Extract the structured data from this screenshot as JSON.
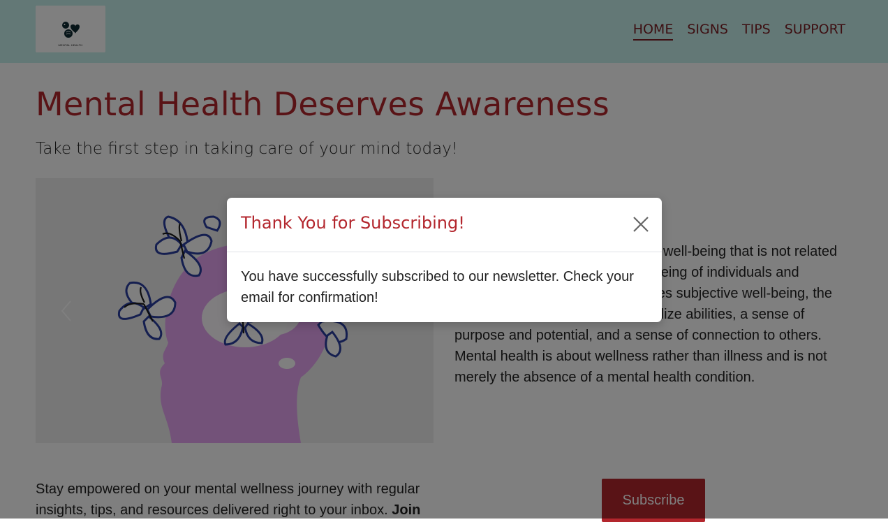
{
  "header": {
    "logo_text": "MENTAL HEALTH",
    "logo_icon": "brain-heart-logo",
    "nav": [
      {
        "label": "HOME",
        "active": true
      },
      {
        "label": "SIGNS"
      },
      {
        "label": "TIPS"
      },
      {
        "label": "SUPPORT"
      }
    ]
  },
  "hero": {
    "title": "Mental Health Deserves Awareness",
    "subtitle": "Take the first step in taking care of your mind today!"
  },
  "carousel": {
    "image": "head-with-butterflies-illustration",
    "prev_icon": "chevron-left-icon"
  },
  "about": {
    "text": "Mental health is a state of mental well-being that is not related to the social and emotional well-being of individuals and communities. The concept includes subjective well-being, the ability to cope with stress and realize abilities, a sense of purpose and potential, and a sense of connection to others. Mental health is about wellness rather than illness and is not merely the absence of a mental health condition."
  },
  "newsletter": {
    "text": "Stay empowered on your mental wellness journey with regular insights, tips, and resources delivered right to your inbox.",
    "bold_text": "Join",
    "button_label": "Subscribe"
  },
  "modal": {
    "title": "Thank You for Subscribing!",
    "body": "You have successfully subscribed to our newsletter. Check your email for confirmation!",
    "close_icon": "close-icon"
  },
  "colors": {
    "accent": "#b3262d",
    "nav_text": "#7b1f24",
    "header_bg": "#c7f1ec",
    "purple_head": "#e6a4f2",
    "butterfly": "#2b3fa0"
  }
}
